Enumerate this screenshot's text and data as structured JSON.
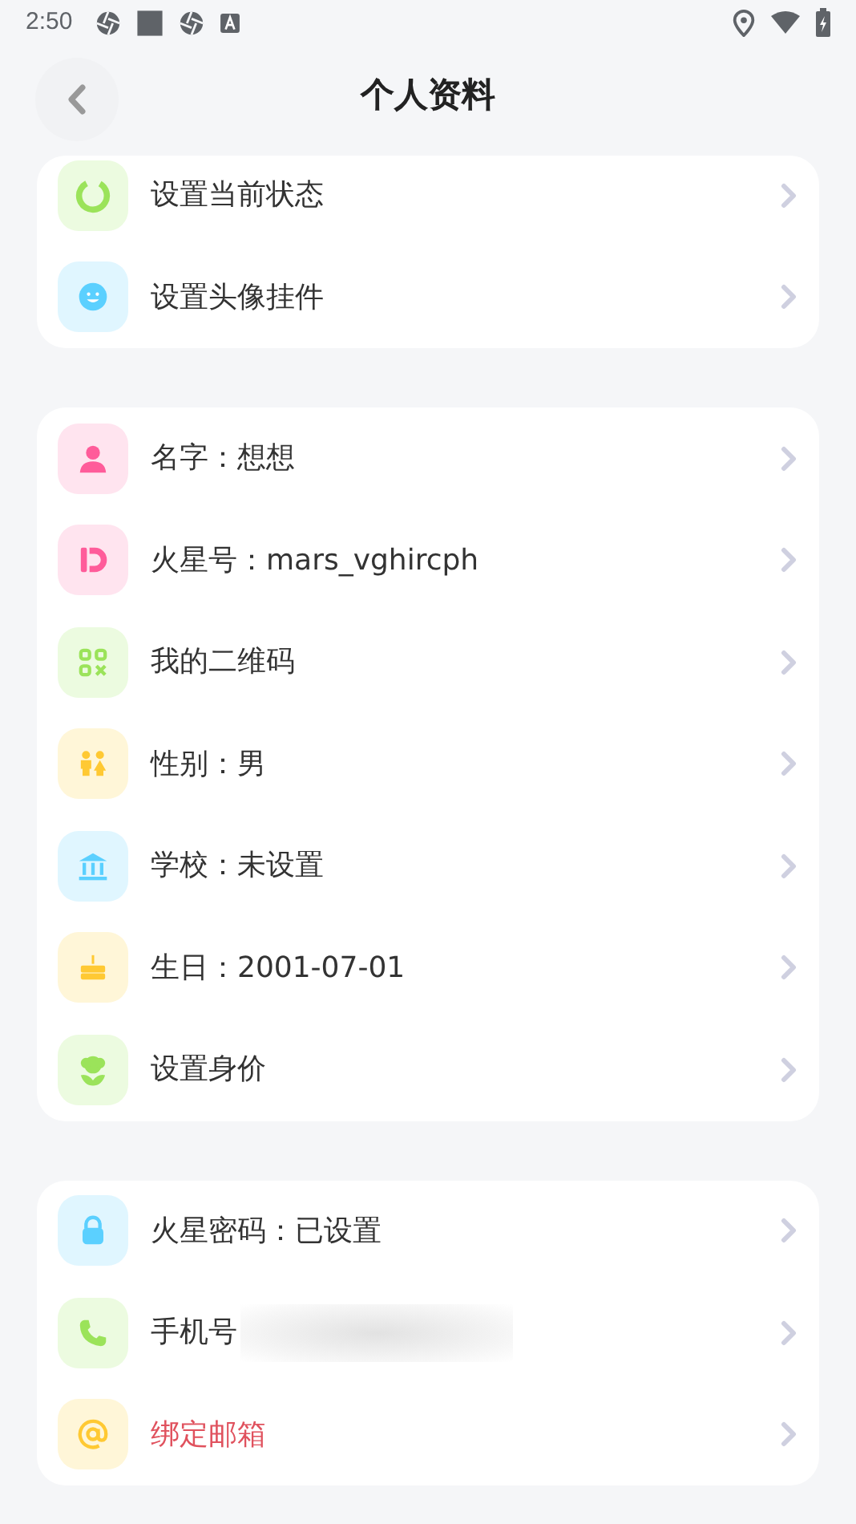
{
  "status_bar": {
    "time": "2:50"
  },
  "header": {
    "title": "个人资料"
  },
  "sections": [
    {
      "rows": [
        {
          "label": "设置当前状态",
          "alert": false
        },
        {
          "label": "设置头像挂件",
          "alert": false
        }
      ]
    },
    {
      "rows": [
        {
          "label": "名字：想想",
          "alert": false
        },
        {
          "label": "火星号：mars_vghircph",
          "alert": false
        },
        {
          "label": "我的二维码",
          "alert": false
        },
        {
          "label": "性别：男",
          "alert": false
        },
        {
          "label": "学校：未设置",
          "alert": false
        },
        {
          "label": "生日：2001-07-01",
          "alert": false
        },
        {
          "label": "设置身价",
          "alert": false
        }
      ]
    },
    {
      "rows": [
        {
          "label": "火星密码：已设置",
          "alert": false
        },
        {
          "label": "手机号",
          "alert": false,
          "redacted": true
        },
        {
          "label": "绑定邮箱",
          "alert": true
        }
      ]
    }
  ]
}
